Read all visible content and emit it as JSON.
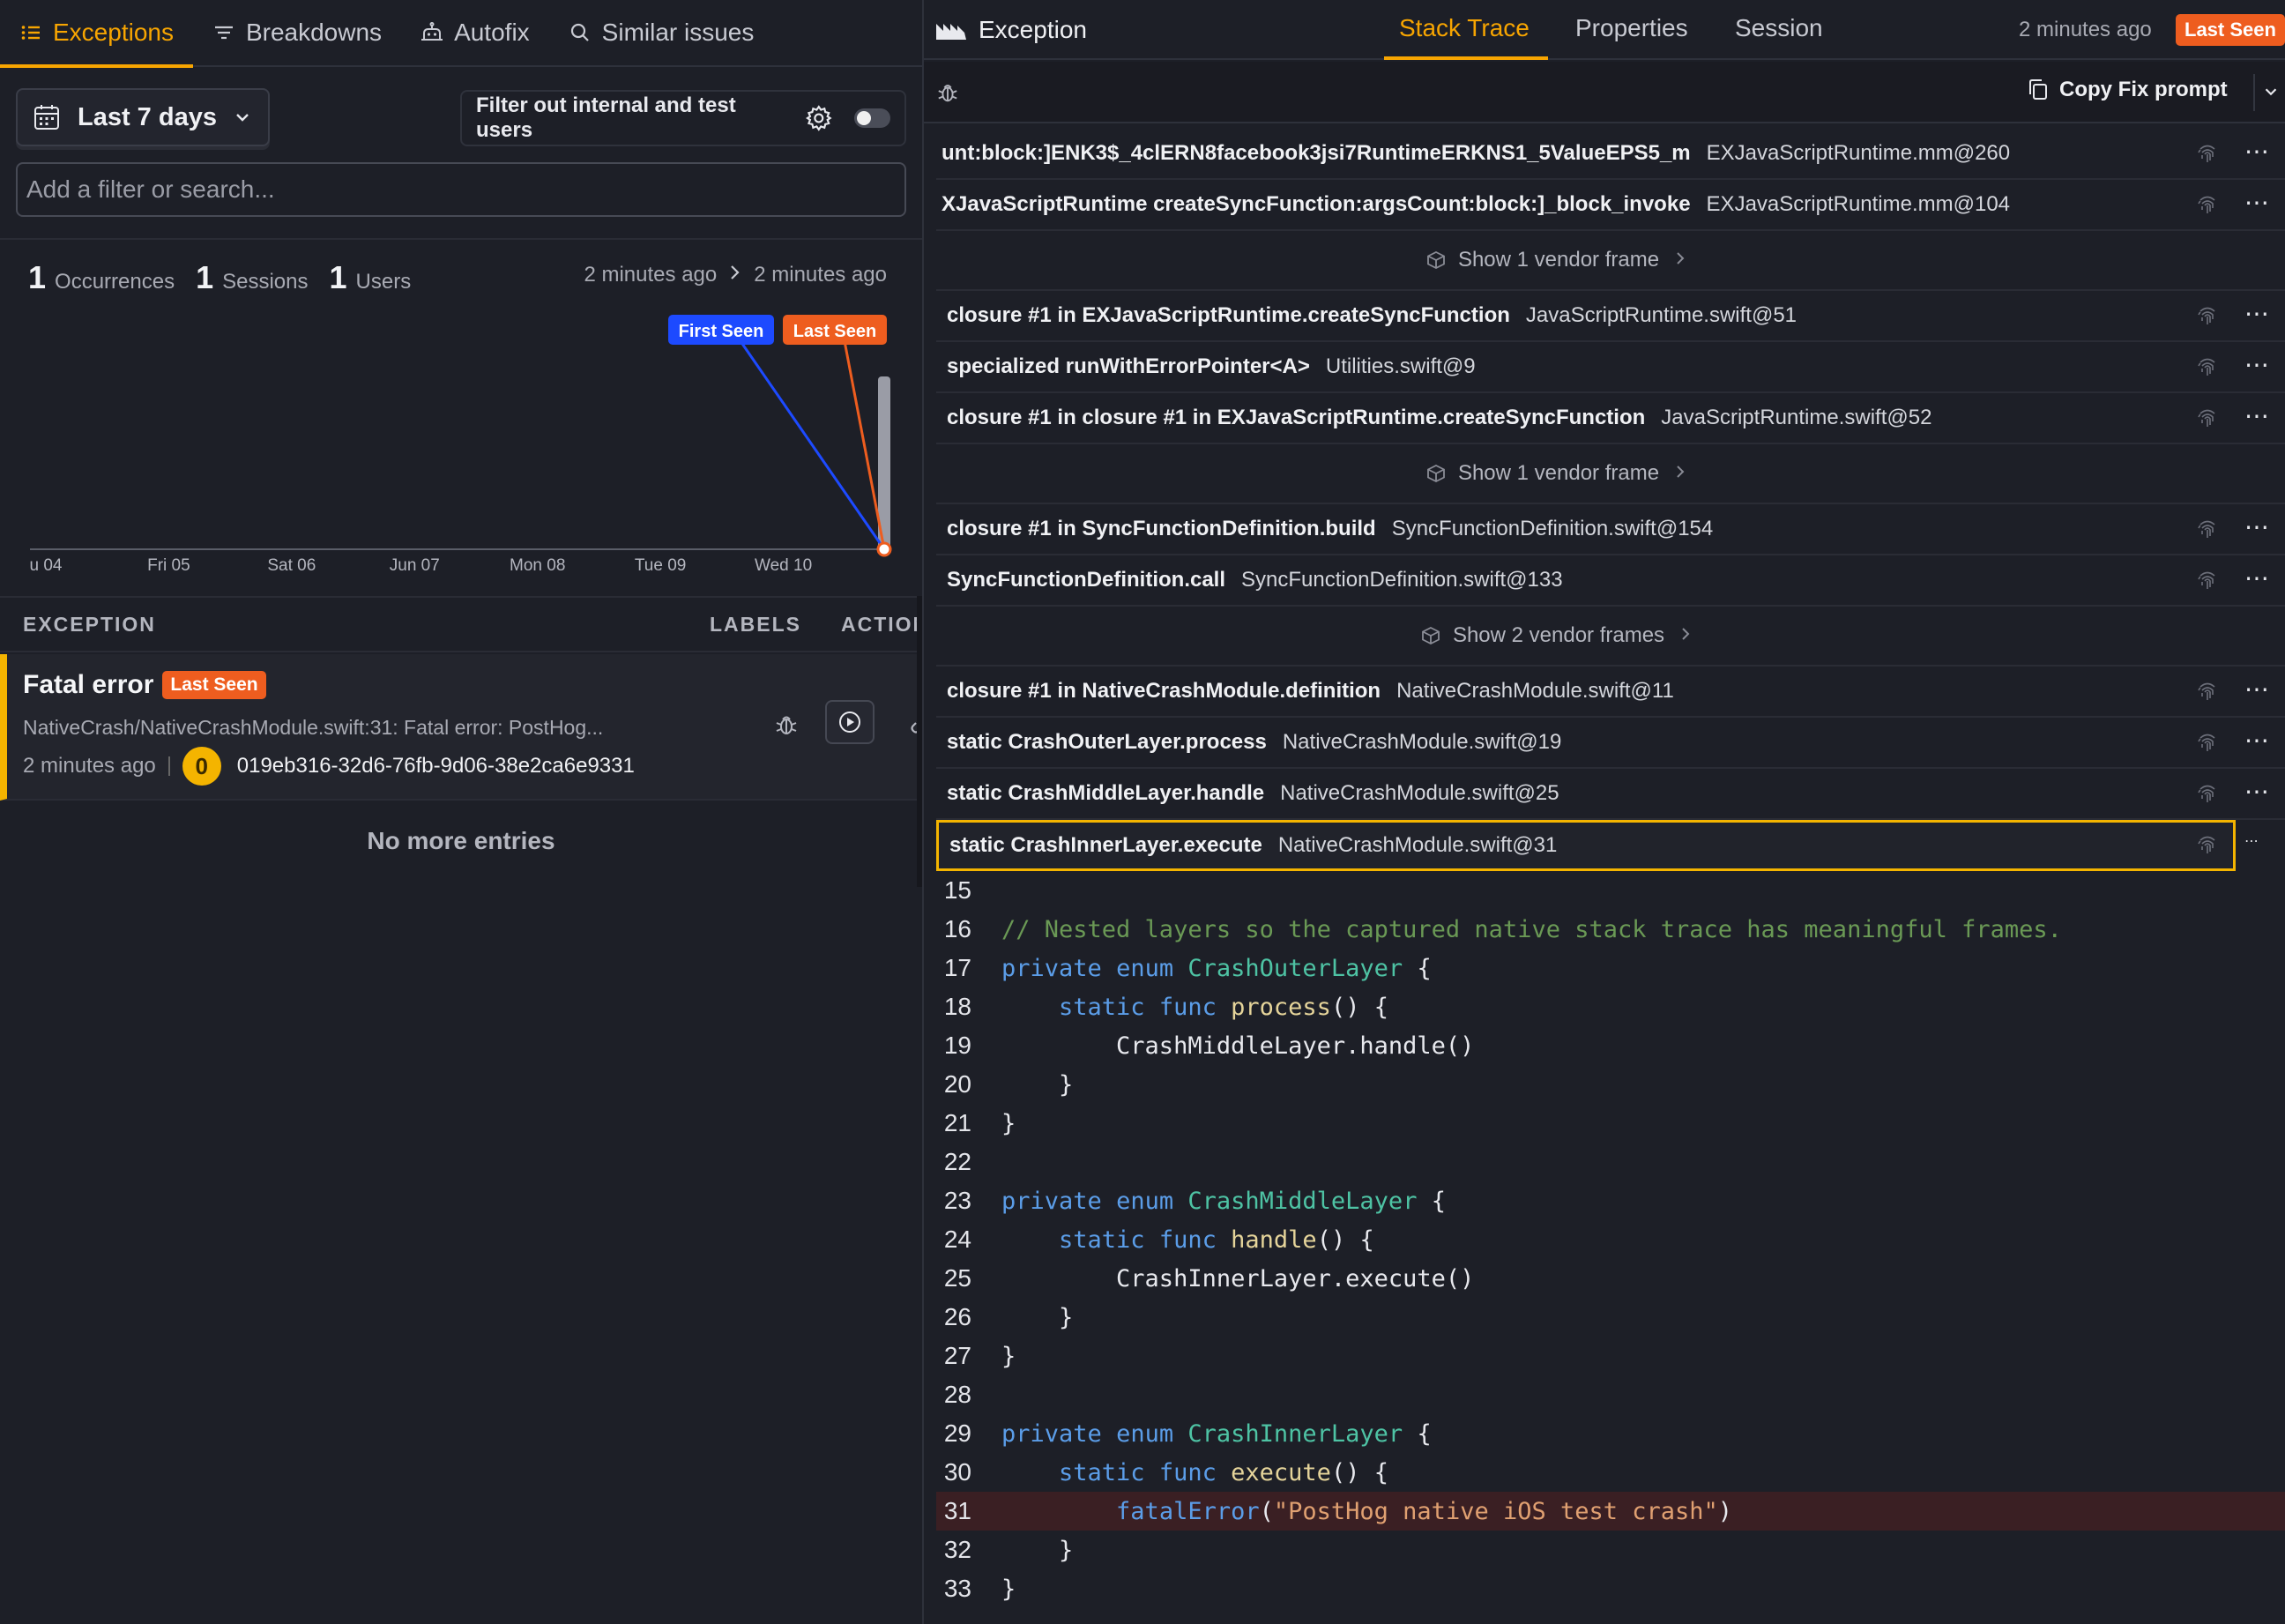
{
  "left_tabs": [
    {
      "label": "Exceptions",
      "icon": "list-icon",
      "active": true
    },
    {
      "label": "Breakdowns",
      "icon": "filter-lines-icon",
      "active": false
    },
    {
      "label": "Autofix",
      "icon": "robot-icon",
      "active": false
    },
    {
      "label": "Similar issues",
      "icon": "search-icon",
      "active": false
    }
  ],
  "filters": {
    "date_range": "Last 7 days",
    "internal_filter_label": "Filter out internal and test users",
    "internal_filter_on": false,
    "search_placeholder": "Add a filter or search..."
  },
  "stats": {
    "occurrences_count": "1",
    "occurrences_label": "Occurrences",
    "sessions_count": "1",
    "sessions_label": "Sessions",
    "users_count": "1",
    "users_label": "Users",
    "first_time": "2 minutes ago",
    "last_time": "2 minutes ago"
  },
  "chart_data": {
    "type": "bar",
    "categories": [
      "u 04",
      "Fri 05",
      "Sat 06",
      "Jun 07",
      "Mon 08",
      "Tue 09",
      "Wed 10"
    ],
    "values": [
      0,
      0,
      0,
      0,
      0,
      0,
      1
    ],
    "annotations": [
      "First Seen",
      "Last Seen"
    ],
    "colors": {
      "first_seen": "#1d4aff",
      "last_seen": "#ee5d1f",
      "bar": "#9a9ca6"
    }
  },
  "exceptions_table": {
    "headers": [
      "EXCEPTION",
      "LABELS",
      "ACTION"
    ],
    "rows": [
      {
        "title": "Fatal error",
        "badge": "Last Seen",
        "message": "NativeCrash/NativeCrashModule.swift:31: Fatal error: PostHog...",
        "time": "2 minutes ago",
        "avatar": "0",
        "id": "019eb316-32d6-76fb-9d06-38e2ca6e9331"
      }
    ],
    "footer": "No more entries"
  },
  "detail": {
    "title": "Exception",
    "tabs": [
      "Stack Trace",
      "Properties",
      "Session"
    ],
    "active_tab": "Stack Trace",
    "time": "2 minutes ago",
    "badge": "Last Seen",
    "copy_label": "Copy Fix prompt"
  },
  "frames": [
    {
      "kind": "frame",
      "fn": "unt:block:]ENK3$_4clERN8facebook3jsi7RuntimeERKNS1_5ValueEPS5_m",
      "file": "EXJavaScriptRuntime.mm@260"
    },
    {
      "kind": "frame",
      "fn": "XJavaScriptRuntime createSyncFunction:argsCount:block:]_block_invoke",
      "file": "EXJavaScriptRuntime.mm@104"
    },
    {
      "kind": "vendor",
      "label": "Show 1 vendor frame"
    },
    {
      "kind": "frame",
      "fn": "closure #1 in EXJavaScriptRuntime.createSyncFunction",
      "file": "JavaScriptRuntime.swift@51"
    },
    {
      "kind": "frame",
      "fn": "specialized runWithErrorPointer<A>",
      "file": "Utilities.swift@9"
    },
    {
      "kind": "frame",
      "fn": "closure #1 in closure #1 in EXJavaScriptRuntime.createSyncFunction",
      "file": "JavaScriptRuntime.swift@52"
    },
    {
      "kind": "vendor",
      "label": "Show 1 vendor frame"
    },
    {
      "kind": "frame",
      "fn": "closure #1 in SyncFunctionDefinition.build",
      "file": "SyncFunctionDefinition.swift@154"
    },
    {
      "kind": "frame",
      "fn": "SyncFunctionDefinition.call",
      "file": "SyncFunctionDefinition.swift@133"
    },
    {
      "kind": "vendor",
      "label": "Show 2 vendor frames"
    },
    {
      "kind": "frame",
      "fn": "closure #1 in NativeCrashModule.definition",
      "file": "NativeCrashModule.swift@11"
    },
    {
      "kind": "frame",
      "fn": "static CrashOuterLayer.process",
      "file": "NativeCrashModule.swift@19"
    },
    {
      "kind": "frame",
      "fn": "static CrashMiddleLayer.handle",
      "file": "NativeCrashModule.swift@25"
    },
    {
      "kind": "frame",
      "fn": "static CrashInnerLayer.execute",
      "file": "NativeCrashModule.swift@31",
      "selected": true
    }
  ],
  "code": {
    "highlight_line": "31",
    "lines": [
      {
        "n": "15",
        "t": ""
      },
      {
        "n": "16",
        "t": "// Nested layers so the captured native stack trace has meaningful frames."
      },
      {
        "n": "17",
        "t": "private enum CrashOuterLayer {"
      },
      {
        "n": "18",
        "t": "    static func process() {"
      },
      {
        "n": "19",
        "t": "        CrashMiddleLayer.handle()"
      },
      {
        "n": "20",
        "t": "    }"
      },
      {
        "n": "21",
        "t": "}"
      },
      {
        "n": "22",
        "t": ""
      },
      {
        "n": "23",
        "t": "private enum CrashMiddleLayer {"
      },
      {
        "n": "24",
        "t": "    static func handle() {"
      },
      {
        "n": "25",
        "t": "        CrashInnerLayer.execute()"
      },
      {
        "n": "26",
        "t": "    }"
      },
      {
        "n": "27",
        "t": "}"
      },
      {
        "n": "28",
        "t": ""
      },
      {
        "n": "29",
        "t": "private enum CrashInnerLayer {"
      },
      {
        "n": "30",
        "t": "    static func execute() {"
      },
      {
        "n": "31",
        "t": "        fatalError(\"PostHog native iOS test crash\")"
      },
      {
        "n": "32",
        "t": "    }"
      },
      {
        "n": "33",
        "t": "}"
      }
    ]
  }
}
